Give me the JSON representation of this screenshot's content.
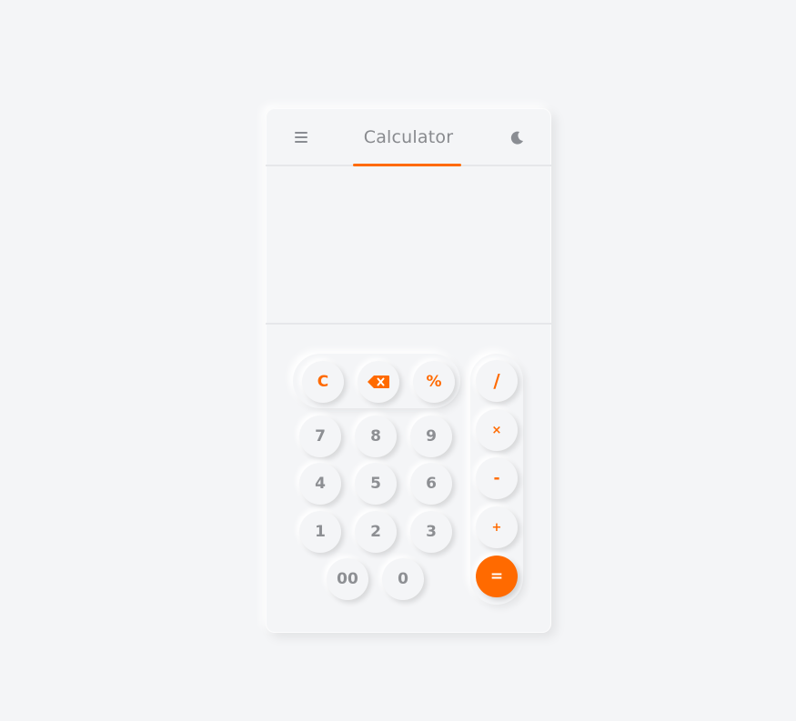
{
  "header": {
    "title": "Calculator",
    "menu_icon": "hamburger-menu-icon",
    "theme_icon": "moon-icon"
  },
  "display": {
    "value": ""
  },
  "keys": {
    "clear": "C",
    "backspace_icon": "backspace-icon",
    "percent": "%",
    "divide": "/",
    "multiply": "×",
    "subtract": "-",
    "add": "+",
    "equals": "=",
    "seven": "7",
    "eight": "8",
    "nine": "9",
    "four": "4",
    "five": "5",
    "six": "6",
    "one": "1",
    "two": "2",
    "three": "3",
    "double_zero": "00",
    "zero": "0"
  },
  "colors": {
    "accent": "#ff6a00",
    "background": "#f4f5f7",
    "text": "#8d8f93"
  }
}
